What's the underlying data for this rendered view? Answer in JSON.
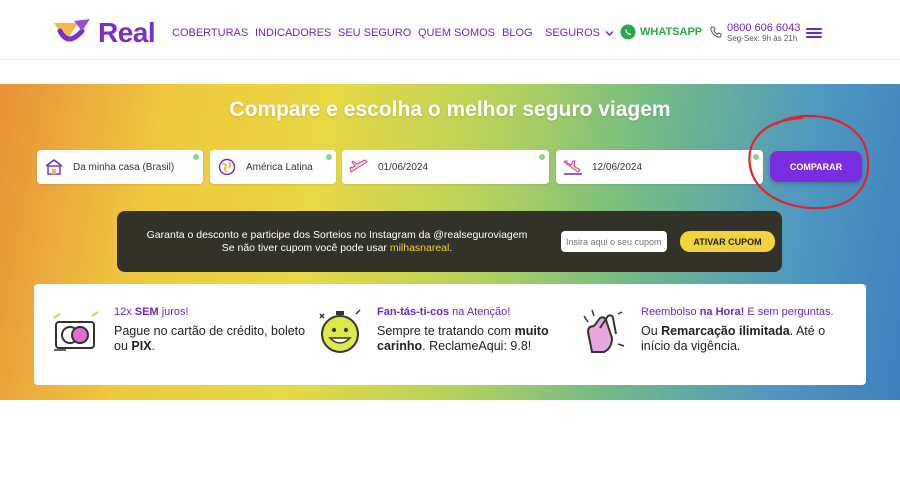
{
  "header": {
    "logo_text": "Real",
    "nav": [
      "COBERTURAS",
      "INDICADORES",
      "SEU SEGURO",
      "QUEM SOMOS",
      "BLOG",
      "SEGUROS"
    ],
    "whatsapp": "WHATSAPP",
    "phone": "0800 606 6043",
    "hours": "Seg-Sex: 9h às 21h"
  },
  "hero": {
    "title": "Compare e escolha o melhor seguro viagem",
    "origin": "Da minha casa (Brasil)",
    "destination": "América Latina",
    "date_start": "01/06/2024",
    "date_end": "12/06/2024",
    "compare_button": "COMPARAR"
  },
  "promo": {
    "line1": "Garanta o desconto e participe dos Sorteios no Instagram da @realseguroviagem",
    "line2_prefix": "Se não tiver cupom você pode usar ",
    "line2_code": "milhasnareal",
    "line2_suffix": ".",
    "coupon_placeholder": "Insira aqui o seu cupom",
    "coupon_button": "ATIVAR CUPOM"
  },
  "benefits": [
    {
      "icon": "credit-card-icon",
      "title_pre": "12x ",
      "title_bold": "SEM",
      "title_post": " juros!",
      "desc_a": "Pague no cartão de crédito, boleto",
      "desc_b": "ou ",
      "desc_b_bold": "PIX",
      "desc_b_end": "."
    },
    {
      "icon": "smiley-clock-icon",
      "title_bold": "Fan-tás-ti-cos",
      "title_post": " na Atenção!",
      "desc_a_pre": "Sempre te tratando com ",
      "desc_a_bold": "muito",
      "desc_b_bold": "carinho",
      "desc_b_end": ". ReclameAqui: 9.8!"
    },
    {
      "icon": "clapping-hands-icon",
      "title_pre": "Reembolso ",
      "title_bold": "na Hora!",
      "title_post": " E sem perguntas.",
      "desc_a_pre": "Ou ",
      "desc_a_bold": "Remarcação ilimitada",
      "desc_a_end": ". Até o",
      "desc_b": "início da vigência."
    }
  ],
  "colors": {
    "brand": "#7b2fc9",
    "whatsapp": "#2aa84a",
    "highlight": "#f3d33c",
    "annotation": "#e0232b"
  }
}
